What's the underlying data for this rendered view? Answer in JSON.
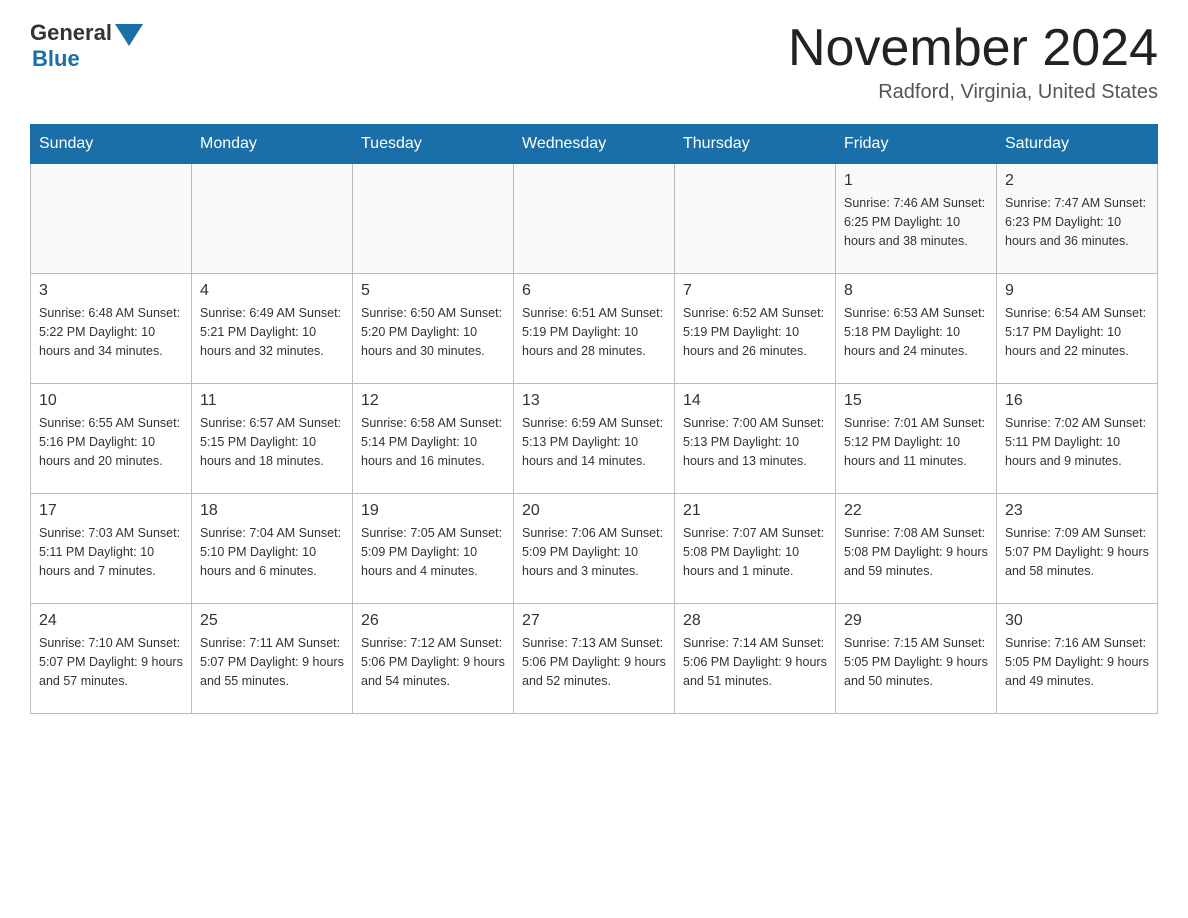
{
  "logo": {
    "general": "General",
    "blue": "Blue"
  },
  "header": {
    "title": "November 2024",
    "subtitle": "Radford, Virginia, United States"
  },
  "weekdays": [
    "Sunday",
    "Monday",
    "Tuesday",
    "Wednesday",
    "Thursday",
    "Friday",
    "Saturday"
  ],
  "weeks": [
    [
      {
        "day": "",
        "info": ""
      },
      {
        "day": "",
        "info": ""
      },
      {
        "day": "",
        "info": ""
      },
      {
        "day": "",
        "info": ""
      },
      {
        "day": "",
        "info": ""
      },
      {
        "day": "1",
        "info": "Sunrise: 7:46 AM\nSunset: 6:25 PM\nDaylight: 10 hours and 38 minutes."
      },
      {
        "day": "2",
        "info": "Sunrise: 7:47 AM\nSunset: 6:23 PM\nDaylight: 10 hours and 36 minutes."
      }
    ],
    [
      {
        "day": "3",
        "info": "Sunrise: 6:48 AM\nSunset: 5:22 PM\nDaylight: 10 hours and 34 minutes."
      },
      {
        "day": "4",
        "info": "Sunrise: 6:49 AM\nSunset: 5:21 PM\nDaylight: 10 hours and 32 minutes."
      },
      {
        "day": "5",
        "info": "Sunrise: 6:50 AM\nSunset: 5:20 PM\nDaylight: 10 hours and 30 minutes."
      },
      {
        "day": "6",
        "info": "Sunrise: 6:51 AM\nSunset: 5:19 PM\nDaylight: 10 hours and 28 minutes."
      },
      {
        "day": "7",
        "info": "Sunrise: 6:52 AM\nSunset: 5:19 PM\nDaylight: 10 hours and 26 minutes."
      },
      {
        "day": "8",
        "info": "Sunrise: 6:53 AM\nSunset: 5:18 PM\nDaylight: 10 hours and 24 minutes."
      },
      {
        "day": "9",
        "info": "Sunrise: 6:54 AM\nSunset: 5:17 PM\nDaylight: 10 hours and 22 minutes."
      }
    ],
    [
      {
        "day": "10",
        "info": "Sunrise: 6:55 AM\nSunset: 5:16 PM\nDaylight: 10 hours and 20 minutes."
      },
      {
        "day": "11",
        "info": "Sunrise: 6:57 AM\nSunset: 5:15 PM\nDaylight: 10 hours and 18 minutes."
      },
      {
        "day": "12",
        "info": "Sunrise: 6:58 AM\nSunset: 5:14 PM\nDaylight: 10 hours and 16 minutes."
      },
      {
        "day": "13",
        "info": "Sunrise: 6:59 AM\nSunset: 5:13 PM\nDaylight: 10 hours and 14 minutes."
      },
      {
        "day": "14",
        "info": "Sunrise: 7:00 AM\nSunset: 5:13 PM\nDaylight: 10 hours and 13 minutes."
      },
      {
        "day": "15",
        "info": "Sunrise: 7:01 AM\nSunset: 5:12 PM\nDaylight: 10 hours and 11 minutes."
      },
      {
        "day": "16",
        "info": "Sunrise: 7:02 AM\nSunset: 5:11 PM\nDaylight: 10 hours and 9 minutes."
      }
    ],
    [
      {
        "day": "17",
        "info": "Sunrise: 7:03 AM\nSunset: 5:11 PM\nDaylight: 10 hours and 7 minutes."
      },
      {
        "day": "18",
        "info": "Sunrise: 7:04 AM\nSunset: 5:10 PM\nDaylight: 10 hours and 6 minutes."
      },
      {
        "day": "19",
        "info": "Sunrise: 7:05 AM\nSunset: 5:09 PM\nDaylight: 10 hours and 4 minutes."
      },
      {
        "day": "20",
        "info": "Sunrise: 7:06 AM\nSunset: 5:09 PM\nDaylight: 10 hours and 3 minutes."
      },
      {
        "day": "21",
        "info": "Sunrise: 7:07 AM\nSunset: 5:08 PM\nDaylight: 10 hours and 1 minute."
      },
      {
        "day": "22",
        "info": "Sunrise: 7:08 AM\nSunset: 5:08 PM\nDaylight: 9 hours and 59 minutes."
      },
      {
        "day": "23",
        "info": "Sunrise: 7:09 AM\nSunset: 5:07 PM\nDaylight: 9 hours and 58 minutes."
      }
    ],
    [
      {
        "day": "24",
        "info": "Sunrise: 7:10 AM\nSunset: 5:07 PM\nDaylight: 9 hours and 57 minutes."
      },
      {
        "day": "25",
        "info": "Sunrise: 7:11 AM\nSunset: 5:07 PM\nDaylight: 9 hours and 55 minutes."
      },
      {
        "day": "26",
        "info": "Sunrise: 7:12 AM\nSunset: 5:06 PM\nDaylight: 9 hours and 54 minutes."
      },
      {
        "day": "27",
        "info": "Sunrise: 7:13 AM\nSunset: 5:06 PM\nDaylight: 9 hours and 52 minutes."
      },
      {
        "day": "28",
        "info": "Sunrise: 7:14 AM\nSunset: 5:06 PM\nDaylight: 9 hours and 51 minutes."
      },
      {
        "day": "29",
        "info": "Sunrise: 7:15 AM\nSunset: 5:05 PM\nDaylight: 9 hours and 50 minutes."
      },
      {
        "day": "30",
        "info": "Sunrise: 7:16 AM\nSunset: 5:05 PM\nDaylight: 9 hours and 49 minutes."
      }
    ]
  ]
}
